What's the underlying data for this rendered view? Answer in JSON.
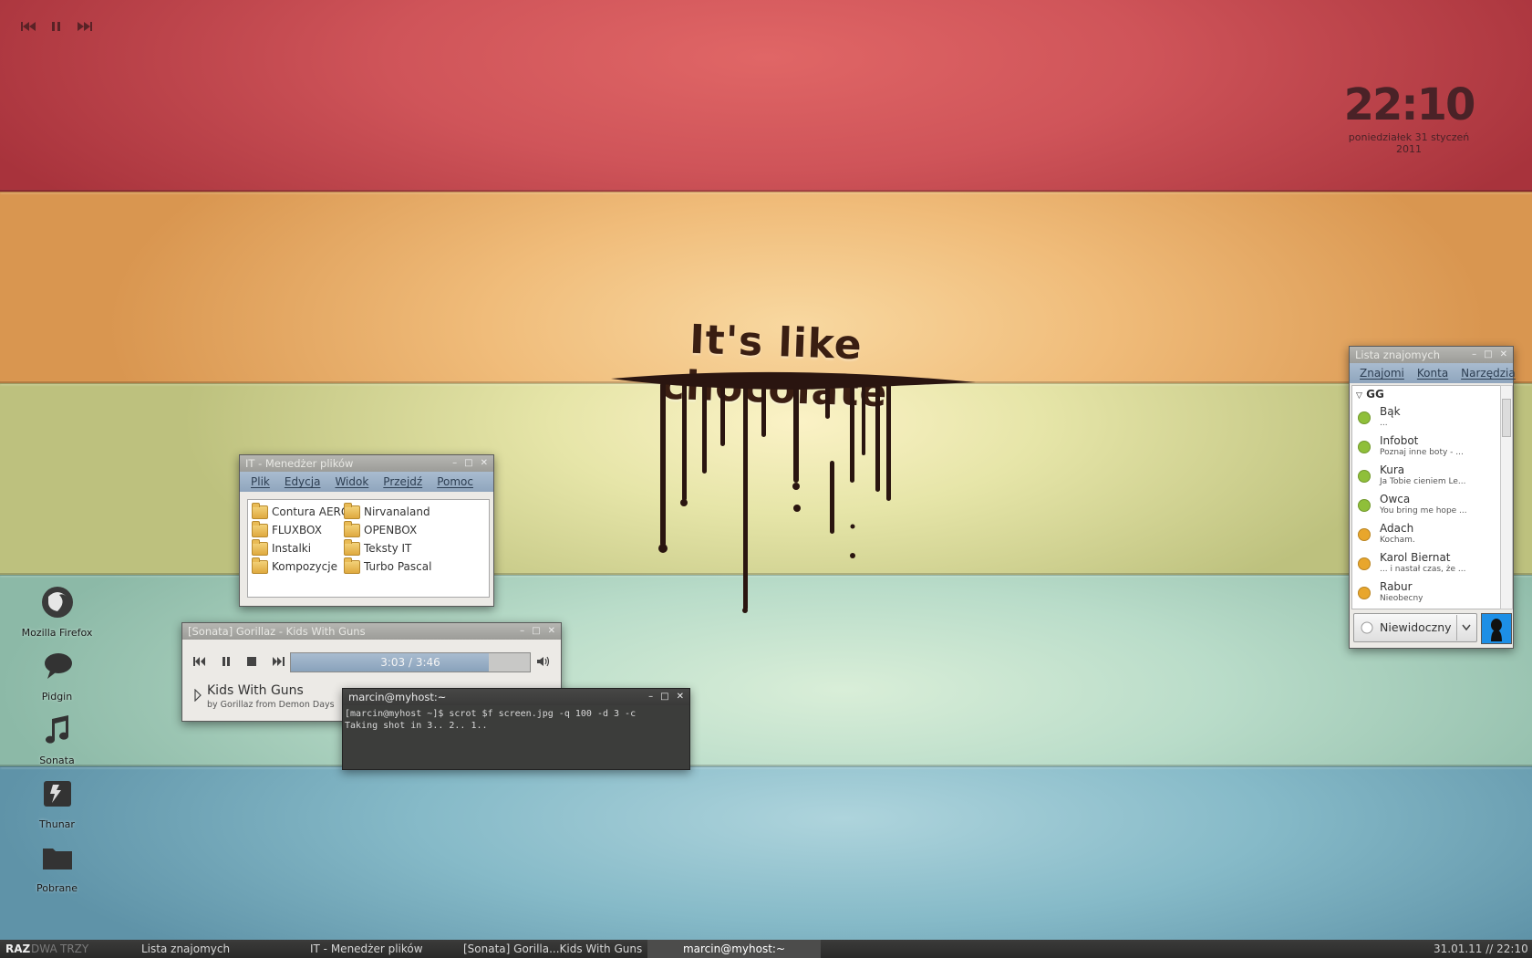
{
  "media_top": {
    "icons": [
      "previous-icon",
      "pause-icon",
      "next-icon"
    ]
  },
  "clock": {
    "time": "22:10",
    "date": "poniedziałek  31 styczeń 2011"
  },
  "wallpaper": {
    "slogan": "It's like chocolate"
  },
  "desktop_icons": [
    {
      "label": "Mozilla Firefox",
      "icon": "firefox-icon"
    },
    {
      "label": "Pidgin",
      "icon": "pidgin-icon"
    },
    {
      "label": "Sonata",
      "icon": "music-note-icon"
    },
    {
      "label": "Thunar",
      "icon": "thunar-icon"
    },
    {
      "label": "Pobrane",
      "icon": "folder-icon"
    }
  ],
  "file_manager": {
    "title": "IT - Menedżer plików",
    "menu": [
      "Plik",
      "Edycja",
      "Widok",
      "Przejdź",
      "Pomoc"
    ],
    "folders": [
      "Contura AERO",
      "FLUXBOX",
      "Instalki",
      "Kompozycje",
      "Nirvanaland",
      "OPENBOX",
      "Teksty IT",
      "Turbo Pascal"
    ]
  },
  "sonata": {
    "title": "[Sonata] Gorillaz - Kids With Guns",
    "time": "3:03 / 3:46",
    "progress": 0.83,
    "track": "Kids With Guns",
    "subtitle": "by Gorillaz from Demon Days"
  },
  "terminal": {
    "title": "marcin@myhost:~",
    "lines": [
      "[marcin@myhost ~]$ scrot $f screen.jpg -q 100 -d 3 -c",
      "Taking shot in 3.. 2.. 1.."
    ]
  },
  "contact_list": {
    "title": "Lista znajomych",
    "menu": [
      "Znajomi",
      "Konta",
      "Narzędzia"
    ],
    "group": "GG",
    "contacts": [
      {
        "name": "Bąk",
        "desc": "...",
        "status": "available"
      },
      {
        "name": "Infobot",
        "desc": "Poznaj inne boty - ...",
        "status": "available"
      },
      {
        "name": "Kura",
        "desc": "Ja Tobie cieniem Le...",
        "status": "available"
      },
      {
        "name": "Owca",
        "desc": "You bring me hope ...",
        "status": "available"
      },
      {
        "name": "Adach",
        "desc": "Kocham.",
        "status": "away"
      },
      {
        "name": "Karol Biernat",
        "desc": "... i nastał czas, że ...",
        "status": "away"
      },
      {
        "name": "Rabur",
        "desc": "Nieobecny",
        "status": "away"
      }
    ],
    "status_value": "Niewidoczny",
    "colors": {
      "available": "#8fbf3a",
      "away": "#e8a62c"
    }
  },
  "taskbar": {
    "workspaces": [
      "RAZ",
      "DWA",
      "TRZY"
    ],
    "tasks": [
      "Lista znajomych",
      "IT - Menedżer plików",
      "[Sonata] Gorilla...Kids With Guns",
      "marcin@myhost:~"
    ],
    "clock": "31.01.11 // 22:10"
  }
}
